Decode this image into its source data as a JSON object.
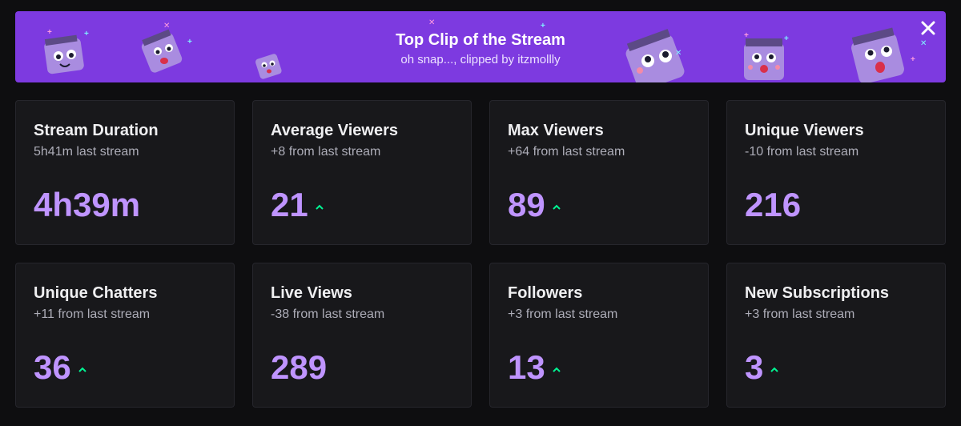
{
  "banner": {
    "title": "Top Clip of the Stream",
    "subtitle": "oh snap..., clipped by itzmollly",
    "close_icon": "close-icon",
    "background": "#7d3ae0"
  },
  "stats": [
    {
      "title": "Stream Duration",
      "comparison": "5h41m last stream",
      "value": "4h39m",
      "trend": "none"
    },
    {
      "title": "Average Viewers",
      "comparison": "+8 from last stream",
      "value": "21",
      "trend": "up"
    },
    {
      "title": "Max Viewers",
      "comparison": "+64 from last stream",
      "value": "89",
      "trend": "up"
    },
    {
      "title": "Unique Viewers",
      "comparison": "-10 from last stream",
      "value": "216",
      "trend": "none"
    },
    {
      "title": "Unique Chatters",
      "comparison": "+11 from last stream",
      "value": "36",
      "trend": "up"
    },
    {
      "title": "Live Views",
      "comparison": "-38 from last stream",
      "value": "289",
      "trend": "none"
    },
    {
      "title": "Followers",
      "comparison": "+3 from last stream",
      "value": "13",
      "trend": "up"
    },
    {
      "title": "New Subscriptions",
      "comparison": "+3 from last stream",
      "value": "3",
      "trend": "up"
    }
  ],
  "colors": {
    "value": "#bf94ff",
    "trend_up": "#00f593",
    "card_bg": "#18181b",
    "page_bg": "#0e0e10"
  }
}
